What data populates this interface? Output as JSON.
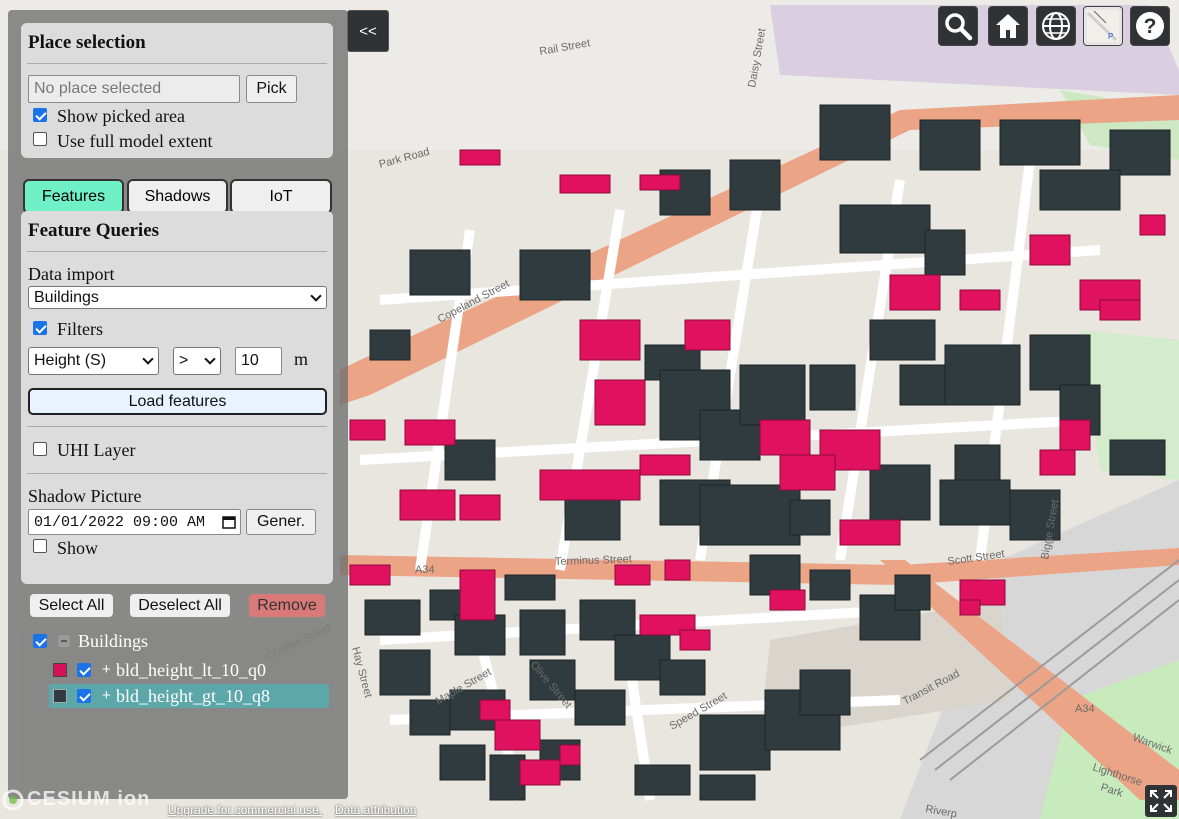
{
  "map": {
    "street_labels": [
      "Copeland Street",
      "Terminus Street",
      "Scott Street",
      "Hay Street",
      "Maple Street",
      "Olive Street",
      "Speed Street",
      "Charles Street",
      "Transit Road",
      "Bigge Street",
      "Lighthorse Park",
      "A34",
      "Warwick",
      "Riverp",
      "Park Road",
      "Rail Street",
      "Daisy Street"
    ],
    "colors": {
      "buildings_low": "#e0115f",
      "buildings_high": "#2f3b3f",
      "road_major": "#eca487",
      "park": "#c9ebc1"
    }
  },
  "toolbar": {
    "collapse_label": "<<",
    "icons": [
      "search-icon",
      "home-icon",
      "globe-icon",
      "base-layer-icon",
      "help-icon"
    ]
  },
  "place_selection": {
    "title": "Place selection",
    "place_placeholder": "No place selected",
    "pick_label": "Pick",
    "show_picked_area": {
      "label": "Show picked area",
      "checked": true
    },
    "use_full_extent": {
      "label": "Use full model extent",
      "checked": false
    }
  },
  "tabs": [
    {
      "label": "Features",
      "active": true
    },
    {
      "label": "Shadows",
      "active": false
    },
    {
      "label": "IoT",
      "active": false
    }
  ],
  "feature_queries": {
    "title": "Feature Queries",
    "data_import_label": "Data import",
    "data_import_value": "Buildings",
    "filters": {
      "label": "Filters",
      "checked": true
    },
    "filter_attribute": "Height (S)",
    "filter_operator": ">",
    "filter_value": "10",
    "filter_unit": "m",
    "load_label": "Load features",
    "uhi_layer": {
      "label": "UHI Layer",
      "checked": false
    },
    "shadow_picture_label": "Shadow Picture",
    "shadow_datetime": "01/01/2022 09:00 AM",
    "generate_label": "Gener.",
    "show": {
      "label": "Show",
      "checked": false
    }
  },
  "layer_actions": {
    "select_all": "Select All",
    "deselect_all": "Deselect All",
    "remove": "Remove"
  },
  "layers": {
    "group_label": "Buildings",
    "group_checked": true,
    "items": [
      {
        "label": "bld_height_lt_10_q0",
        "color": "#d6125a",
        "checked": true,
        "selected": false
      },
      {
        "label": "bld_height_gt_10_q8",
        "color": "#2f3b3f",
        "checked": true,
        "selected": true
      }
    ]
  },
  "credits": {
    "logo": "CESIUM ion",
    "upgrade": "Upgrade for commercial use.",
    "attribution": "Data attribution"
  }
}
